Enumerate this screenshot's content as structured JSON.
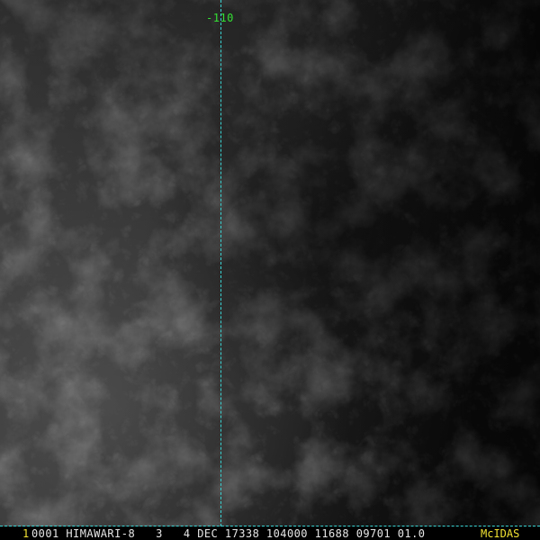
{
  "overlay": {
    "longitude_label": "-110"
  },
  "status_bar": {
    "frame_number": "1",
    "info_text": "0001 HIMAWARI-8   3   4 DEC 17338 104000 11688 09701 01.0",
    "brand": "McIDAS"
  },
  "colors": {
    "grid_line": "#3ad4d4",
    "label_green": "#33e033",
    "label_yellow": "#f2e233",
    "status_text": "#e6e6e6"
  }
}
